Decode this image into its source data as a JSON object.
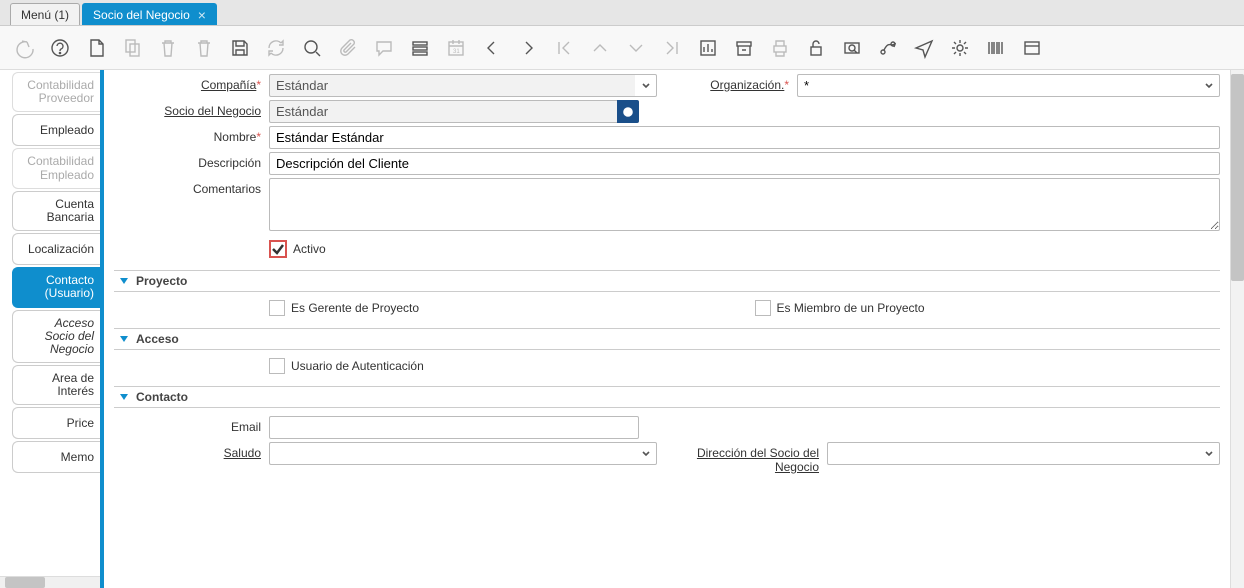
{
  "topTabs": [
    {
      "label": "Menú (1)",
      "active": false
    },
    {
      "label": "Socio del Negocio",
      "active": true
    }
  ],
  "sideTabs": [
    {
      "label": "Contabilidad Proveedor",
      "state": "disabled"
    },
    {
      "label": "Empleado"
    },
    {
      "label": "Contabilidad Empleado",
      "state": "disabled"
    },
    {
      "label": "Cuenta Bancaria"
    },
    {
      "label": "Localización"
    },
    {
      "label": "Contacto (Usuario)",
      "state": "active"
    },
    {
      "label": "Acceso Socio del Negocio",
      "state": "italic"
    },
    {
      "label": "Area de Interés"
    },
    {
      "label": "Price"
    },
    {
      "label": "Memo"
    }
  ],
  "form": {
    "compania_label": "Compañía",
    "compania_value": "Estándar",
    "organizacion_label": "Organización.",
    "organizacion_value": "*",
    "socio_label": "Socio del Negocio",
    "socio_value": "Estándar",
    "nombre_label": "Nombre",
    "nombre_value": "Estándar Estándar",
    "descripcion_label": "Descripción",
    "descripcion_value": "Descripción del Cliente",
    "comentarios_label": "Comentarios",
    "comentarios_value": "",
    "activo_label": "Activo",
    "activo_checked": true
  },
  "sections": {
    "proyecto_title": "Proyecto",
    "gerente_label": "Es Gerente de Proyecto",
    "miembro_label": "Es Miembro de un Proyecto",
    "acceso_title": "Acceso",
    "auth_label": "Usuario de Autenticación",
    "contacto_title": "Contacto",
    "email_label": "Email",
    "email_value": "",
    "saludo_label": "Saludo",
    "saludo_value": "",
    "direccion_label": "Dirección del Socio del Negocio",
    "direccion_value": ""
  }
}
